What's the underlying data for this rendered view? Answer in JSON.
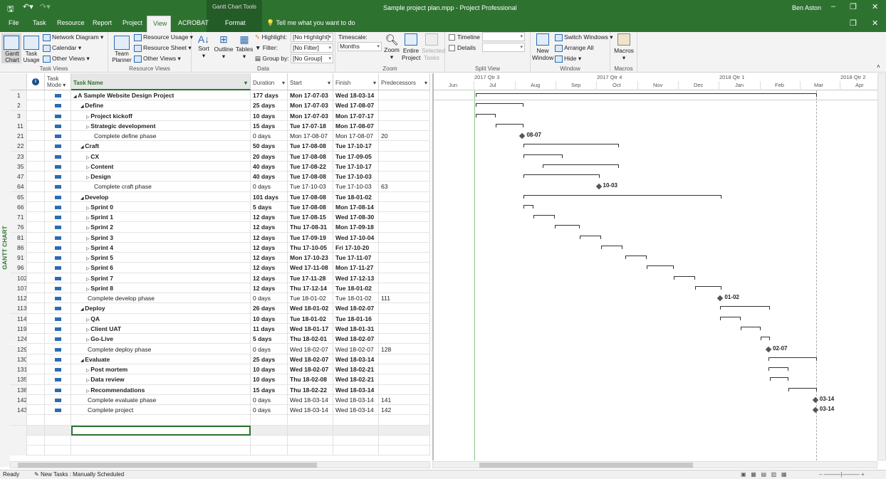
{
  "window": {
    "title": "Sample project plan.mpp  -  Project Professional",
    "user": "Ben Aston",
    "context_tab_group": "Gantt Chart Tools",
    "tell_me": "Tell me what you want to do"
  },
  "tabs": [
    "File",
    "Task",
    "Resource",
    "Report",
    "Project",
    "View",
    "ACROBAT",
    "Format"
  ],
  "active_tab": "View",
  "ribbon": {
    "task_views": {
      "label": "Task Views",
      "gantt": "Gantt Chart",
      "task_usage": "Task Usage",
      "network": "Network Diagram",
      "calendar": "Calendar",
      "other": "Other Views"
    },
    "resource_views": {
      "label": "Resource Views",
      "team_planner": "Team Planner",
      "usage": "Resource Usage",
      "sheet": "Resource Sheet",
      "other": "Other Views"
    },
    "data": {
      "label": "Data",
      "sort": "Sort",
      "outline": "Outline",
      "tables": "Tables",
      "highlight": "Highlight:",
      "highlight_val": "[No Highlight]",
      "filter": "Filter:",
      "filter_val": "[No Filter]",
      "group": "Group by:",
      "group_val": "[No Group]"
    },
    "zoom": {
      "label": "Zoom",
      "timescale": "Timescale:",
      "timescale_val": "Months",
      "zoom": "Zoom",
      "entire": "Entire Project",
      "selected": "Selected Tasks"
    },
    "split": {
      "label": "Split View",
      "timeline": "Timeline",
      "details": "Details"
    },
    "window": {
      "label": "Window",
      "new": "New Window",
      "switch": "Switch Windows",
      "arrange": "Arrange All",
      "hide": "Hide"
    },
    "macros": {
      "label": "Macros",
      "macros": "Macros"
    }
  },
  "side_label": "GANTT CHART",
  "columns": {
    "mode": "Task Mode",
    "name": "Task Name",
    "duration": "Duration",
    "start": "Start",
    "finish": "Finish",
    "pred": "Predecessors"
  },
  "timescale": {
    "quarters": [
      "2017 Qtr 3",
      "2017 Qtr 4",
      "2018 Qtr 1",
      "2018 Qtr 2"
    ],
    "months": [
      "Jun",
      "Jul",
      "Aug",
      "Sep",
      "Oct",
      "Nov",
      "Dec",
      "Jan",
      "Feb",
      "Mar",
      "Apr"
    ]
  },
  "tasks": [
    {
      "id": "1",
      "name": "A Sample Website Design Project",
      "lvl": 0,
      "sum": "open",
      "dur": "177 days",
      "start": "Mon 17-07-03",
      "finish": "Wed 18-03-14",
      "pred": ""
    },
    {
      "id": "2",
      "name": "Define",
      "lvl": 1,
      "sum": "open",
      "dur": "25 days",
      "start": "Mon 17-07-03",
      "finish": "Wed 17-08-07",
      "pred": ""
    },
    {
      "id": "3",
      "name": "Project kickoff",
      "lvl": 2,
      "sum": "closed",
      "dur": "10 days",
      "start": "Mon 17-07-03",
      "finish": "Mon 17-07-17",
      "pred": ""
    },
    {
      "id": "11",
      "name": "Strategic development",
      "lvl": 2,
      "sum": "closed",
      "dur": "15 days",
      "start": "Tue 17-07-18",
      "finish": "Mon 17-08-07",
      "pred": ""
    },
    {
      "id": "21",
      "name": "Complete define phase",
      "lvl": 2,
      "sum": "",
      "dur": "0 days",
      "start": "Mon 17-08-07",
      "finish": "Mon 17-08-07",
      "pred": "20"
    },
    {
      "id": "22",
      "name": "Craft",
      "lvl": 1,
      "sum": "open",
      "dur": "50 days",
      "start": "Tue 17-08-08",
      "finish": "Tue 17-10-17",
      "pred": ""
    },
    {
      "id": "23",
      "name": "CX",
      "lvl": 2,
      "sum": "closed",
      "dur": "20 days",
      "start": "Tue 17-08-08",
      "finish": "Tue 17-09-05",
      "pred": ""
    },
    {
      "id": "35",
      "name": "Content",
      "lvl": 2,
      "sum": "closed",
      "dur": "40 days",
      "start": "Tue 17-08-22",
      "finish": "Tue 17-10-17",
      "pred": ""
    },
    {
      "id": "47",
      "name": "Design",
      "lvl": 2,
      "sum": "closed",
      "dur": "40 days",
      "start": "Tue 17-08-08",
      "finish": "Tue 17-10-03",
      "pred": ""
    },
    {
      "id": "64",
      "name": "Complete craft phase",
      "lvl": 2,
      "sum": "",
      "dur": "0 days",
      "start": "Tue 17-10-03",
      "finish": "Tue 17-10-03",
      "pred": "63"
    },
    {
      "id": "65",
      "name": "Develop",
      "lvl": 1,
      "sum": "open",
      "dur": "101 days",
      "start": "Tue 17-08-08",
      "finish": "Tue 18-01-02",
      "pred": ""
    },
    {
      "id": "66",
      "name": "Sprint 0",
      "lvl": 2,
      "sum": "closed",
      "dur": "5 days",
      "start": "Tue 17-08-08",
      "finish": "Mon 17-08-14",
      "pred": ""
    },
    {
      "id": "71",
      "name": "Sprint 1",
      "lvl": 2,
      "sum": "closed",
      "dur": "12 days",
      "start": "Tue 17-08-15",
      "finish": "Wed 17-08-30",
      "pred": ""
    },
    {
      "id": "76",
      "name": "Sprint 2",
      "lvl": 2,
      "sum": "closed",
      "dur": "12 days",
      "start": "Thu 17-08-31",
      "finish": "Mon 17-09-18",
      "pred": ""
    },
    {
      "id": "81",
      "name": "Sprint 3",
      "lvl": 2,
      "sum": "closed",
      "dur": "12 days",
      "start": "Tue 17-09-19",
      "finish": "Wed 17-10-04",
      "pred": ""
    },
    {
      "id": "86",
      "name": "Sprint 4",
      "lvl": 2,
      "sum": "closed",
      "dur": "12 days",
      "start": "Thu 17-10-05",
      "finish": "Fri 17-10-20",
      "pred": ""
    },
    {
      "id": "91",
      "name": "Sprint 5",
      "lvl": 2,
      "sum": "closed",
      "dur": "12 days",
      "start": "Mon 17-10-23",
      "finish": "Tue 17-11-07",
      "pred": ""
    },
    {
      "id": "96",
      "name": "Sprint 6",
      "lvl": 2,
      "sum": "closed",
      "dur": "12 days",
      "start": "Wed 17-11-08",
      "finish": "Mon 17-11-27",
      "pred": ""
    },
    {
      "id": "102",
      "name": "Sprint 7",
      "lvl": 2,
      "sum": "closed",
      "dur": "12 days",
      "start": "Tue 17-11-28",
      "finish": "Wed 17-12-13",
      "pred": ""
    },
    {
      "id": "107",
      "name": "Sprint 8",
      "lvl": 2,
      "sum": "closed",
      "dur": "12 days",
      "start": "Thu 17-12-14",
      "finish": "Tue 18-01-02",
      "pred": ""
    },
    {
      "id": "112",
      "name": "Complete develop phase",
      "lvl": 1,
      "sum": "",
      "dur": "0 days",
      "start": "Tue 18-01-02",
      "finish": "Tue 18-01-02",
      "pred": "111"
    },
    {
      "id": "113",
      "name": "Deploy",
      "lvl": 1,
      "sum": "open",
      "dur": "26 days",
      "start": "Wed 18-01-02",
      "finish": "Wed 18-02-07",
      "pred": ""
    },
    {
      "id": "114",
      "name": "QA",
      "lvl": 2,
      "sum": "closed",
      "dur": "10 days",
      "start": "Tue 18-01-02",
      "finish": "Tue 18-01-16",
      "pred": ""
    },
    {
      "id": "119",
      "name": "Client UAT",
      "lvl": 2,
      "sum": "closed",
      "dur": "11 days",
      "start": "Wed 18-01-17",
      "finish": "Wed 18-01-31",
      "pred": ""
    },
    {
      "id": "124",
      "name": "Go-Live",
      "lvl": 2,
      "sum": "closed",
      "dur": "5 days",
      "start": "Thu 18-02-01",
      "finish": "Wed 18-02-07",
      "pred": ""
    },
    {
      "id": "129",
      "name": "Complete deploy phase",
      "lvl": 1,
      "sum": "",
      "dur": "0 days",
      "start": "Wed 18-02-07",
      "finish": "Wed 18-02-07",
      "pred": "128"
    },
    {
      "id": "130",
      "name": "Evaluate",
      "lvl": 1,
      "sum": "open",
      "dur": "25 days",
      "start": "Wed 18-02-07",
      "finish": "Wed 18-03-14",
      "pred": ""
    },
    {
      "id": "131",
      "name": "Post mortem",
      "lvl": 2,
      "sum": "closed",
      "dur": "10 days",
      "start": "Wed 18-02-07",
      "finish": "Wed 18-02-21",
      "pred": ""
    },
    {
      "id": "135",
      "name": "Data review",
      "lvl": 2,
      "sum": "closed",
      "dur": "10 days",
      "start": "Thu 18-02-08",
      "finish": "Wed 18-02-21",
      "pred": ""
    },
    {
      "id": "138",
      "name": "Recommendations",
      "lvl": 2,
      "sum": "closed",
      "dur": "15 days",
      "start": "Thu 18-02-22",
      "finish": "Wed 18-03-14",
      "pred": ""
    },
    {
      "id": "142",
      "name": "Complete evaluate phase",
      "lvl": 1,
      "sum": "",
      "dur": "0 days",
      "start": "Wed 18-03-14",
      "finish": "Wed 18-03-14",
      "pred": "141"
    },
    {
      "id": "143",
      "name": "Complete project",
      "lvl": 1,
      "sum": "",
      "dur": "0 days",
      "start": "Wed 18-03-14",
      "finish": "Wed 18-03-14",
      "pred": "142"
    }
  ],
  "status": {
    "ready": "Ready",
    "new_tasks": "New Tasks : Manually Scheduled"
  },
  "colors": {
    "brand": "#2e7230"
  }
}
